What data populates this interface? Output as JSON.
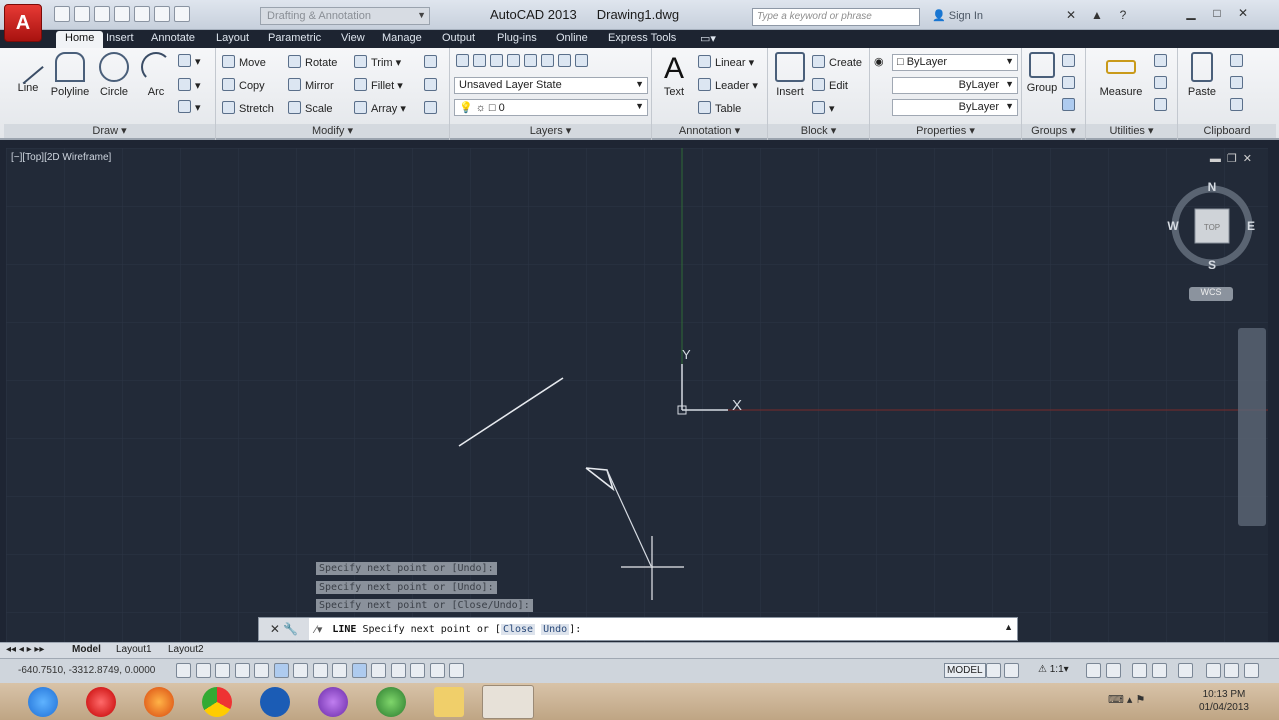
{
  "titlebar": {
    "app_button": "A",
    "workspace": "Drafting & Annotation",
    "app_title": "AutoCAD 2013",
    "doc_title": "Drawing1.dwg",
    "search_placeholder": "Type a keyword or phrase",
    "signin": "Sign In",
    "help": "?"
  },
  "tabs": [
    "Home",
    "Insert",
    "Annotate",
    "Layout",
    "Parametric",
    "View",
    "Manage",
    "Output",
    "Plug-ins",
    "Online",
    "Express Tools"
  ],
  "ribbon": {
    "draw": {
      "title": "Draw",
      "line": "Line",
      "polyline": "Polyline",
      "circle": "Circle",
      "arc": "Arc"
    },
    "modify": {
      "title": "Modify",
      "move": "Move",
      "rotate": "Rotate",
      "trim": "Trim",
      "copy": "Copy",
      "mirror": "Mirror",
      "fillet": "Fillet",
      "stretch": "Stretch",
      "scale": "Scale",
      "array": "Array"
    },
    "layers": {
      "title": "Layers",
      "state": "Unsaved Layer State",
      "current": "0"
    },
    "annotation": {
      "title": "Annotation",
      "text": "Text",
      "linear": "Linear",
      "leader": "Leader",
      "table": "Table"
    },
    "block": {
      "title": "Block",
      "insert": "Insert",
      "create": "Create",
      "edit": "Edit"
    },
    "properties": {
      "title": "Properties",
      "color": "ByLayer",
      "linetype": "ByLayer",
      "lineweight": "ByLayer"
    },
    "groups": {
      "title": "Groups",
      "group": "Group"
    },
    "utilities": {
      "title": "Utilities",
      "measure": "Measure"
    },
    "clipboard": {
      "title": "Clipboard",
      "paste": "Paste"
    }
  },
  "viewport": {
    "label": "[−][Top][2D Wireframe]",
    "compass": {
      "n": "N",
      "s": "S",
      "e": "E",
      "w": "W",
      "top": "TOP"
    },
    "wcs": "WCS",
    "ucs_x": "X",
    "ucs_y": "Y"
  },
  "history": [
    "Specify next point or [Undo]:",
    "Specify next point or [Undo]:",
    "Specify next point or [Close/Undo]:"
  ],
  "command": {
    "prefix": "LINE",
    "text": "Specify next point or [",
    "close": "Close",
    "undo": "Undo",
    "suffix": "]:"
  },
  "layout_tabs": [
    "Model",
    "Layout1",
    "Layout2"
  ],
  "status": {
    "coords": "-640.7510, -3312.8749, 0.0000",
    "model": "MODEL",
    "scale": "1:1"
  },
  "taskbar": {
    "time": "10:13 PM",
    "date": "01/04/2013"
  },
  "colors": {
    "bg": "#222a38",
    "x_axis": "#a23030",
    "y_axis": "#2f6a36",
    "accent": "#c8201b"
  }
}
